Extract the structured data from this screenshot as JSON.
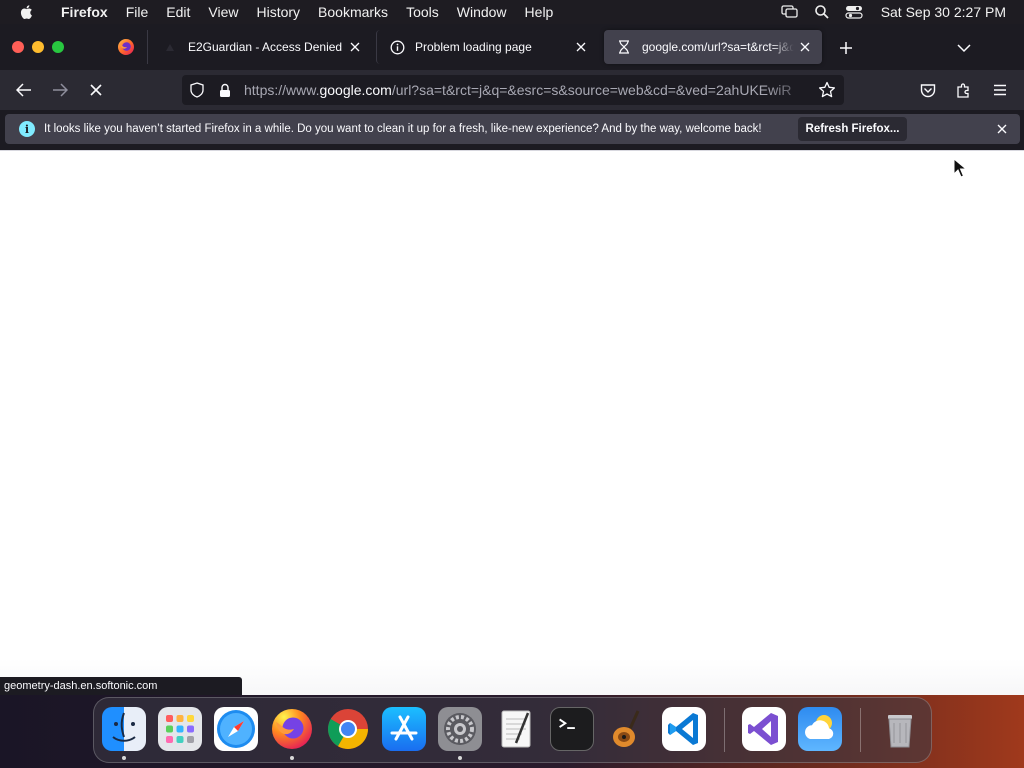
{
  "menubar": {
    "apple_icon": "apple-logo-icon",
    "app_name": "Firefox",
    "items": [
      "File",
      "Edit",
      "View",
      "History",
      "Bookmarks",
      "Tools",
      "Window",
      "Help"
    ],
    "status_icons": [
      "screen-mirroring-icon",
      "spotlight-search-icon",
      "control-center-icon"
    ],
    "clock": "Sat Sep 30  2:27 PM"
  },
  "tabs": {
    "pinned": {
      "icon": "firefox-icon"
    },
    "items": [
      {
        "label": "E2Guardian - Access Denied",
        "icon": "e2guardian-icon",
        "active": false
      },
      {
        "label": "Problem loading page",
        "icon": "info-circle-icon",
        "active": false
      },
      {
        "label": "google.com/url?sa=t&rct=j&q=&esrc",
        "icon": "hourglass-loading-icon",
        "active": true
      }
    ],
    "new_tab_icon": "plus-icon",
    "list_all_tabs_icon": "chevron-down-icon"
  },
  "navbar": {
    "back_icon": "arrow-left-icon",
    "forward_icon": "arrow-right-icon",
    "stop_icon": "stop-x-icon",
    "url_prefix": "https://www.",
    "url_domain": "google.com",
    "url_rest": "/url?sa=t&rct=j&q=&esrc=s&source=web&cd=&ved=2ahUKEwiR",
    "tracking_icon": "shield-icon",
    "lock_icon": "lock-icon",
    "bookmark_icon": "star-icon",
    "pocket_icon": "pocket-icon",
    "extensions_icon": "puzzle-piece-icon",
    "menu_icon": "hamburger-menu-icon"
  },
  "notification": {
    "icon": "info-icon",
    "message": "It looks like you haven’t started Firefox in a while. Do you want to clean it up for a fresh, like-new experience? And by the way, welcome back!",
    "button_label": "Refresh Firefox...",
    "close_icon": "close-icon"
  },
  "status_url": "geometry-dash.en.softonic.com",
  "dock": {
    "apps": [
      {
        "name": "Finder",
        "icon": "finder-icon",
        "running": true
      },
      {
        "name": "Launchpad",
        "icon": "launchpad-icon",
        "running": false
      },
      {
        "name": "Safari",
        "icon": "safari-icon",
        "running": false
      },
      {
        "name": "Firefox",
        "icon": "firefox-icon",
        "running": true
      },
      {
        "name": "Google Chrome",
        "icon": "chrome-icon",
        "running": false
      },
      {
        "name": "App Store",
        "icon": "app-store-icon",
        "running": false
      },
      {
        "name": "System Preferences",
        "icon": "system-preferences-icon",
        "running": true
      },
      {
        "name": "TextEdit",
        "icon": "textedit-icon",
        "running": false
      },
      {
        "name": "Terminal",
        "icon": "terminal-icon",
        "running": false
      },
      {
        "name": "GarageBand",
        "icon": "garageband-icon",
        "running": false
      },
      {
        "name": "Visual Studio Code",
        "icon": "vscode-icon",
        "running": false
      },
      {
        "name": "Visual Studio",
        "icon": "visual-studio-icon",
        "running": false
      },
      {
        "name": "Weather",
        "icon": "weather-icon",
        "running": false
      },
      {
        "name": "Trash",
        "icon": "trash-icon",
        "running": false
      }
    ]
  },
  "colors": {
    "toolbar": "#2b2a33",
    "tabstrip": "#1c1b22",
    "active_tab": "#42414d",
    "info_accent": "#80ebff"
  }
}
